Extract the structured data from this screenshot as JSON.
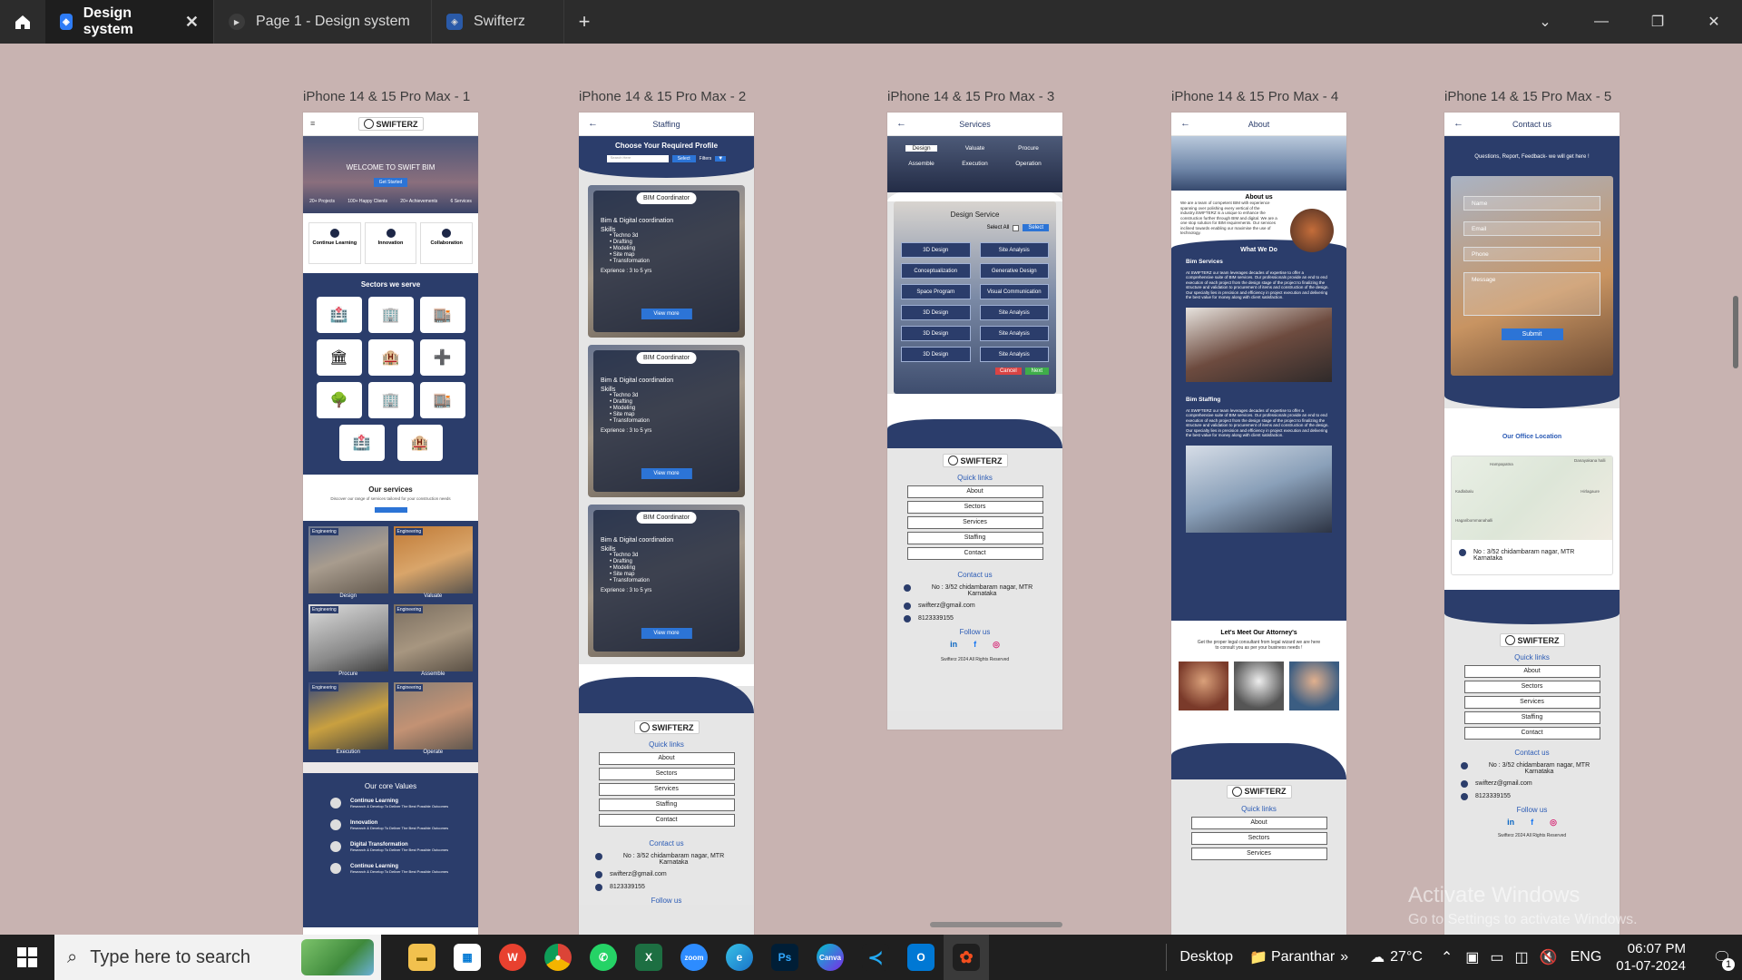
{
  "tabs": [
    {
      "label": "Design system",
      "active": true
    },
    {
      "label": "Page 1 - Design system",
      "active": false
    },
    {
      "label": "Swifterz",
      "active": false
    }
  ],
  "frames": [
    {
      "label": "iPhone 14 & 15 Pro Max - 1"
    },
    {
      "label": "iPhone 14 & 15 Pro Max - 2"
    },
    {
      "label": "iPhone 14 & 15 Pro Max - 3"
    },
    {
      "label": "iPhone 14 & 15 Pro Max - 4"
    },
    {
      "label": "iPhone 14 & 15 Pro Max - 5"
    }
  ],
  "brand": "SWIFTERZ",
  "f1": {
    "hero": "WELCOME TO SWIFT BIM",
    "get_started": "Get Started",
    "stats": [
      "20+ Projects",
      "100+ Happy Clients",
      "20+ Achievements",
      "6 Services"
    ],
    "values": [
      "Continue Learning",
      "Innovation",
      "Collaboration"
    ],
    "sectors_title": "Sectors we serve",
    "services_title": "Our services",
    "services_sub": "Discover our range of services tailored for your construction needs",
    "services": [
      "Design",
      "Valuate",
      "Procure",
      "Assemble",
      "Execution",
      "Operate"
    ],
    "tag": "Engineering",
    "core_title": "Our core Values",
    "core": [
      "Continue Learning",
      "Innovation",
      "Digital Transformation",
      "Continue Learning"
    ],
    "core_sub": "Research & Develop To Deliver The Best Possible Outcomes"
  },
  "f2": {
    "title": "Staffing",
    "heading": "Choose Your Required Profile",
    "search_placeholder": "Search Here",
    "select": "Select",
    "filters": "Filters",
    "card_title": "BIM Coordinator",
    "card_sub": "Bim & Digital coordination",
    "skills": "Skills",
    "skill_list": [
      "Techno 3d",
      "Drafting",
      "Modeling",
      "Site map",
      "Transformation"
    ],
    "exp": "Exprience : 3 to 5 yrs",
    "view": "View more"
  },
  "f3": {
    "title": "Services",
    "menu": [
      "Design",
      "Valuate",
      "Procure",
      "Assemble",
      "Execution",
      "Operation"
    ],
    "panel_title": "Design Service",
    "select_all": "Select All",
    "select": "Select",
    "grid": [
      [
        "3D Design",
        "Site Analysis"
      ],
      [
        "Conceptualization",
        "Generative Design"
      ],
      [
        "Space Program",
        "Visual Communication"
      ],
      [
        "3D Design",
        "Site Analysis"
      ],
      [
        "3D Design",
        "Site Analysis"
      ],
      [
        "3D Design",
        "Site Analysis"
      ]
    ],
    "cancel": "Cancel",
    "next": "Next"
  },
  "f4": {
    "title": "About",
    "about_title": "About us",
    "about_text": "We are a team of competent BIM with experience spanning over polishing every vertical of the industry.SWIFTERZ is a unique to enhance the construction further through BIM and digital. We are a one stop solution for BIM requirements. Our services inclined towards enabling our maximise the use of technology.",
    "what_title": "What We Do",
    "bim_services": "Bim Services",
    "bim_staffing": "Bim Staffing",
    "para": "At SWIFTERZ our team leverages decades of expertise to offer a comprehensive suite of BIM services. Our professionals provide an end to end execution of each project from the design stage of the project to finalizing the structure and validation to procurement of items and construction of the design. Our specialty lies in precision and efficiency in project execution and delivering the best value for money along with client satisfaction.",
    "meet": "Let's Meet Our Attorney's",
    "meet_sub": "Get the proper legal consultant from legal wizard we are here to consult you as per your business needs !"
  },
  "f5": {
    "title": "Contact us",
    "lead": "Questions, Report, Feedback- we will get here !",
    "fields": [
      "Name",
      "Email",
      "Phone",
      "Message"
    ],
    "submit": "Submit",
    "office": "Our Office Location",
    "map_labels": [
      "Hampapatna",
      "Danayakana halli",
      "Kadlabalu",
      "Hirlagaure",
      "Hagaribommanahalli"
    ]
  },
  "footer": {
    "quick": "Quick links",
    "links": [
      "About",
      "Sectors",
      "Services",
      "Staffing",
      "Contact"
    ],
    "contact_title": "Contact us",
    "address": "No : 3/52 chidambaram nagar, MTR Karnataka",
    "email": "swifterz@gmail.com",
    "phone": "8123339155",
    "follow": "Follow us",
    "copyright": "Swifterz 2024 All Rights Reserved"
  },
  "watermark": {
    "line1": "Activate Windows",
    "line2": "Go to Settings to activate Windows."
  },
  "taskbar": {
    "search_placeholder": "Type here to search",
    "desktop": "Desktop",
    "user": "Paranthar",
    "weather": "27°C",
    "lang": "ENG",
    "time": "06:07 PM",
    "date": "01-07-2024",
    "notif": "1"
  },
  "colors": {
    "navy": "#2b3d6b",
    "accent": "#2c74d6",
    "canvas": "#c8b3b1"
  }
}
